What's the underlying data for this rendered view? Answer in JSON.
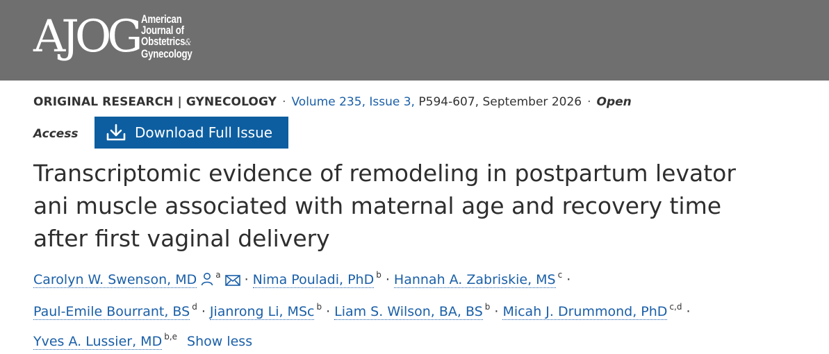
{
  "header": {
    "logo_mark": "AJOG",
    "logo_lines": [
      "American",
      "Journal of",
      "Obstetrics",
      "Gynecology"
    ],
    "logo_amp": "&",
    "background": "#6f6f6f"
  },
  "meta": {
    "category": "ORIGINAL RESEARCH | GYNECOLOGY",
    "separator": "·",
    "volume_link": "Volume 235, Issue 3,",
    "pages_date": " P594-607, September 2026",
    "open": "Open",
    "access": "Access"
  },
  "download": {
    "label": "Download Full Issue",
    "icon": "download-icon",
    "color": "#0d5ea0"
  },
  "article": {
    "title": "Transcriptomic evidence of remodeling in postpartum levator ani muscle associated with maternal age and recovery time after first vaginal delivery"
  },
  "authors": [
    {
      "name": "Carolyn W. Swenson, MD",
      "aff": "a",
      "icons": [
        "person-icon",
        "envelope-icon"
      ]
    },
    {
      "name": "Nima Pouladi, PhD",
      "aff": "b"
    },
    {
      "name": "Hannah A. Zabriskie, MS",
      "aff": "c"
    },
    {
      "name": "Paul-Emile Bourrant, BS",
      "aff": "d"
    },
    {
      "name": "Jianrong Li, MSc",
      "aff": "b"
    },
    {
      "name": "Liam S. Wilson, BA, BS",
      "aff": "b"
    },
    {
      "name": "Micah J. Drummond, PhD",
      "aff": "c,d"
    },
    {
      "name": "Yves A. Lussier, MD",
      "aff": "b,e"
    }
  ],
  "authors_toggle": "Show less",
  "dot": "·",
  "link_color": "#1a5fa8"
}
